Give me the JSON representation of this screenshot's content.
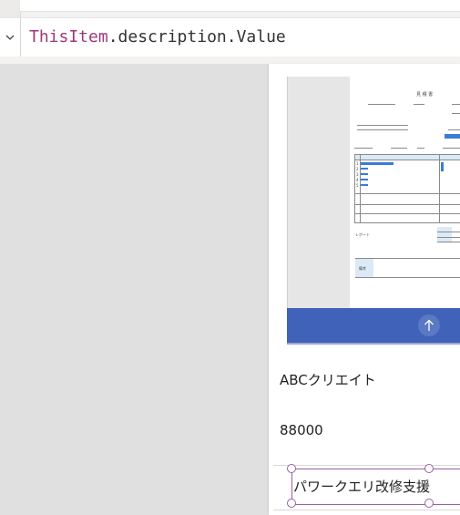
{
  "formula": {
    "keyword": "ThisItem",
    "rest": ".description.Value",
    "chevron": "chevron-down-icon"
  },
  "gallery": {
    "company_name": "ABCクリエイト",
    "amount": "88000",
    "description": "パワークエリ改修支援",
    "upload_icon": "arrow-up-icon",
    "accent_color": "#4062b8",
    "selection_color": "#9a5fa8"
  },
  "doc_preview": {
    "title": "見 積 書",
    "row_labels": [
      "1",
      "2",
      "3",
      "4",
      "5"
    ],
    "remarks_label": "備考",
    "footer_label": "レポート"
  }
}
